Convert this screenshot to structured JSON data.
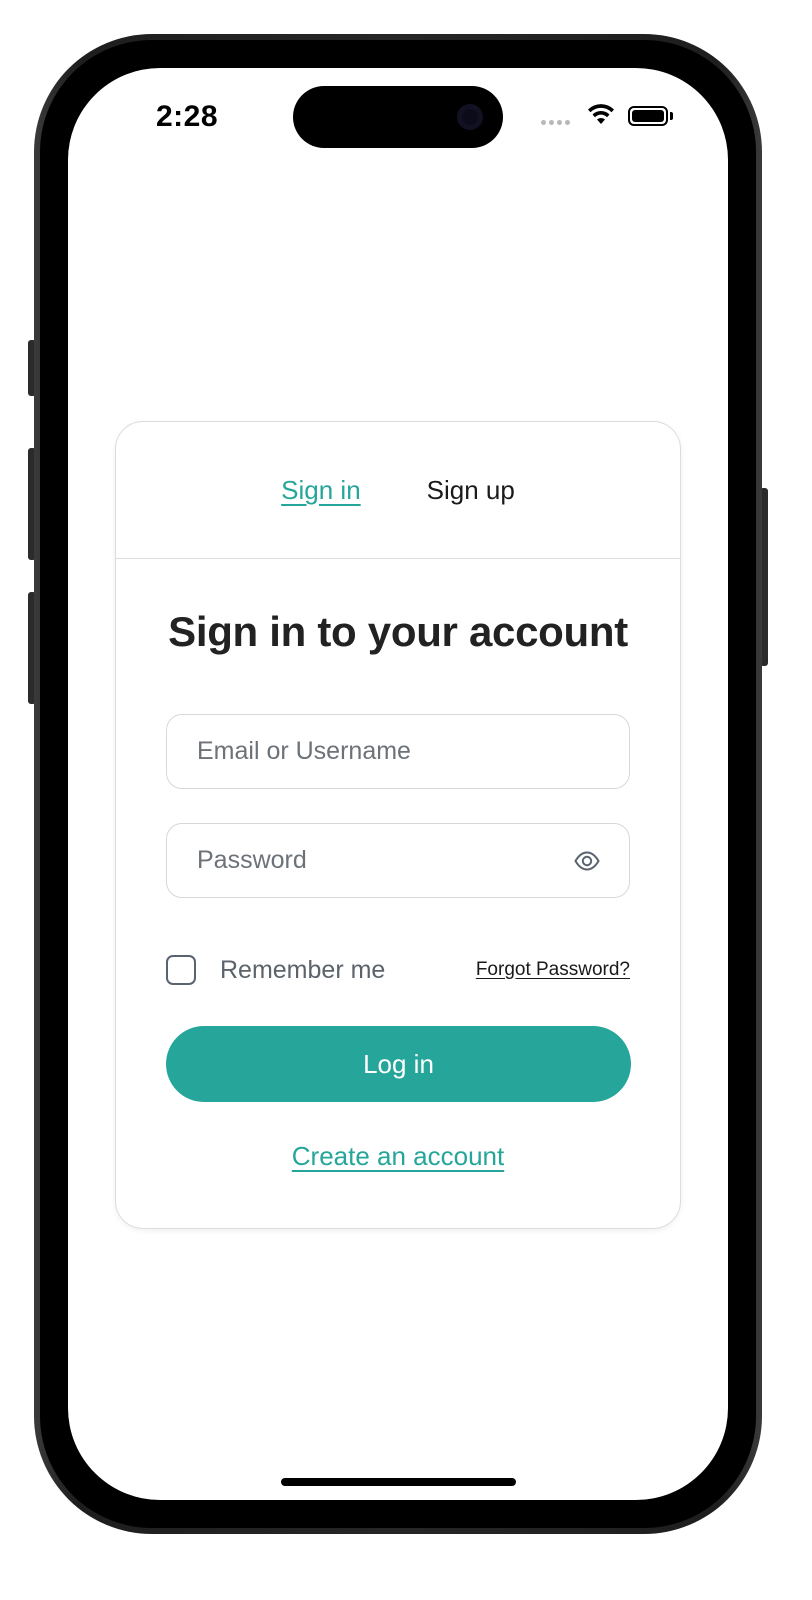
{
  "status_bar": {
    "time": "2:28"
  },
  "tabs": [
    {
      "label": "Sign in",
      "active": true
    },
    {
      "label": "Sign up",
      "active": false
    }
  ],
  "form": {
    "title": "Sign in to your account",
    "email_placeholder": "Email or Username",
    "email_value": "",
    "password_placeholder": "Password",
    "password_value": "",
    "remember_label": "Remember me",
    "remember_checked": false,
    "forgot_label": "Forgot Password?",
    "login_label": "Log in",
    "create_account_label": "Create an account"
  },
  "icons": {
    "password_toggle": "eye-icon",
    "wifi": "wifi-icon",
    "battery": "battery-icon",
    "signal": "signal-icon"
  },
  "colors": {
    "accent": "#26a69a",
    "text": "#222222",
    "muted": "#6c7278",
    "border": "#dcdcdc"
  }
}
